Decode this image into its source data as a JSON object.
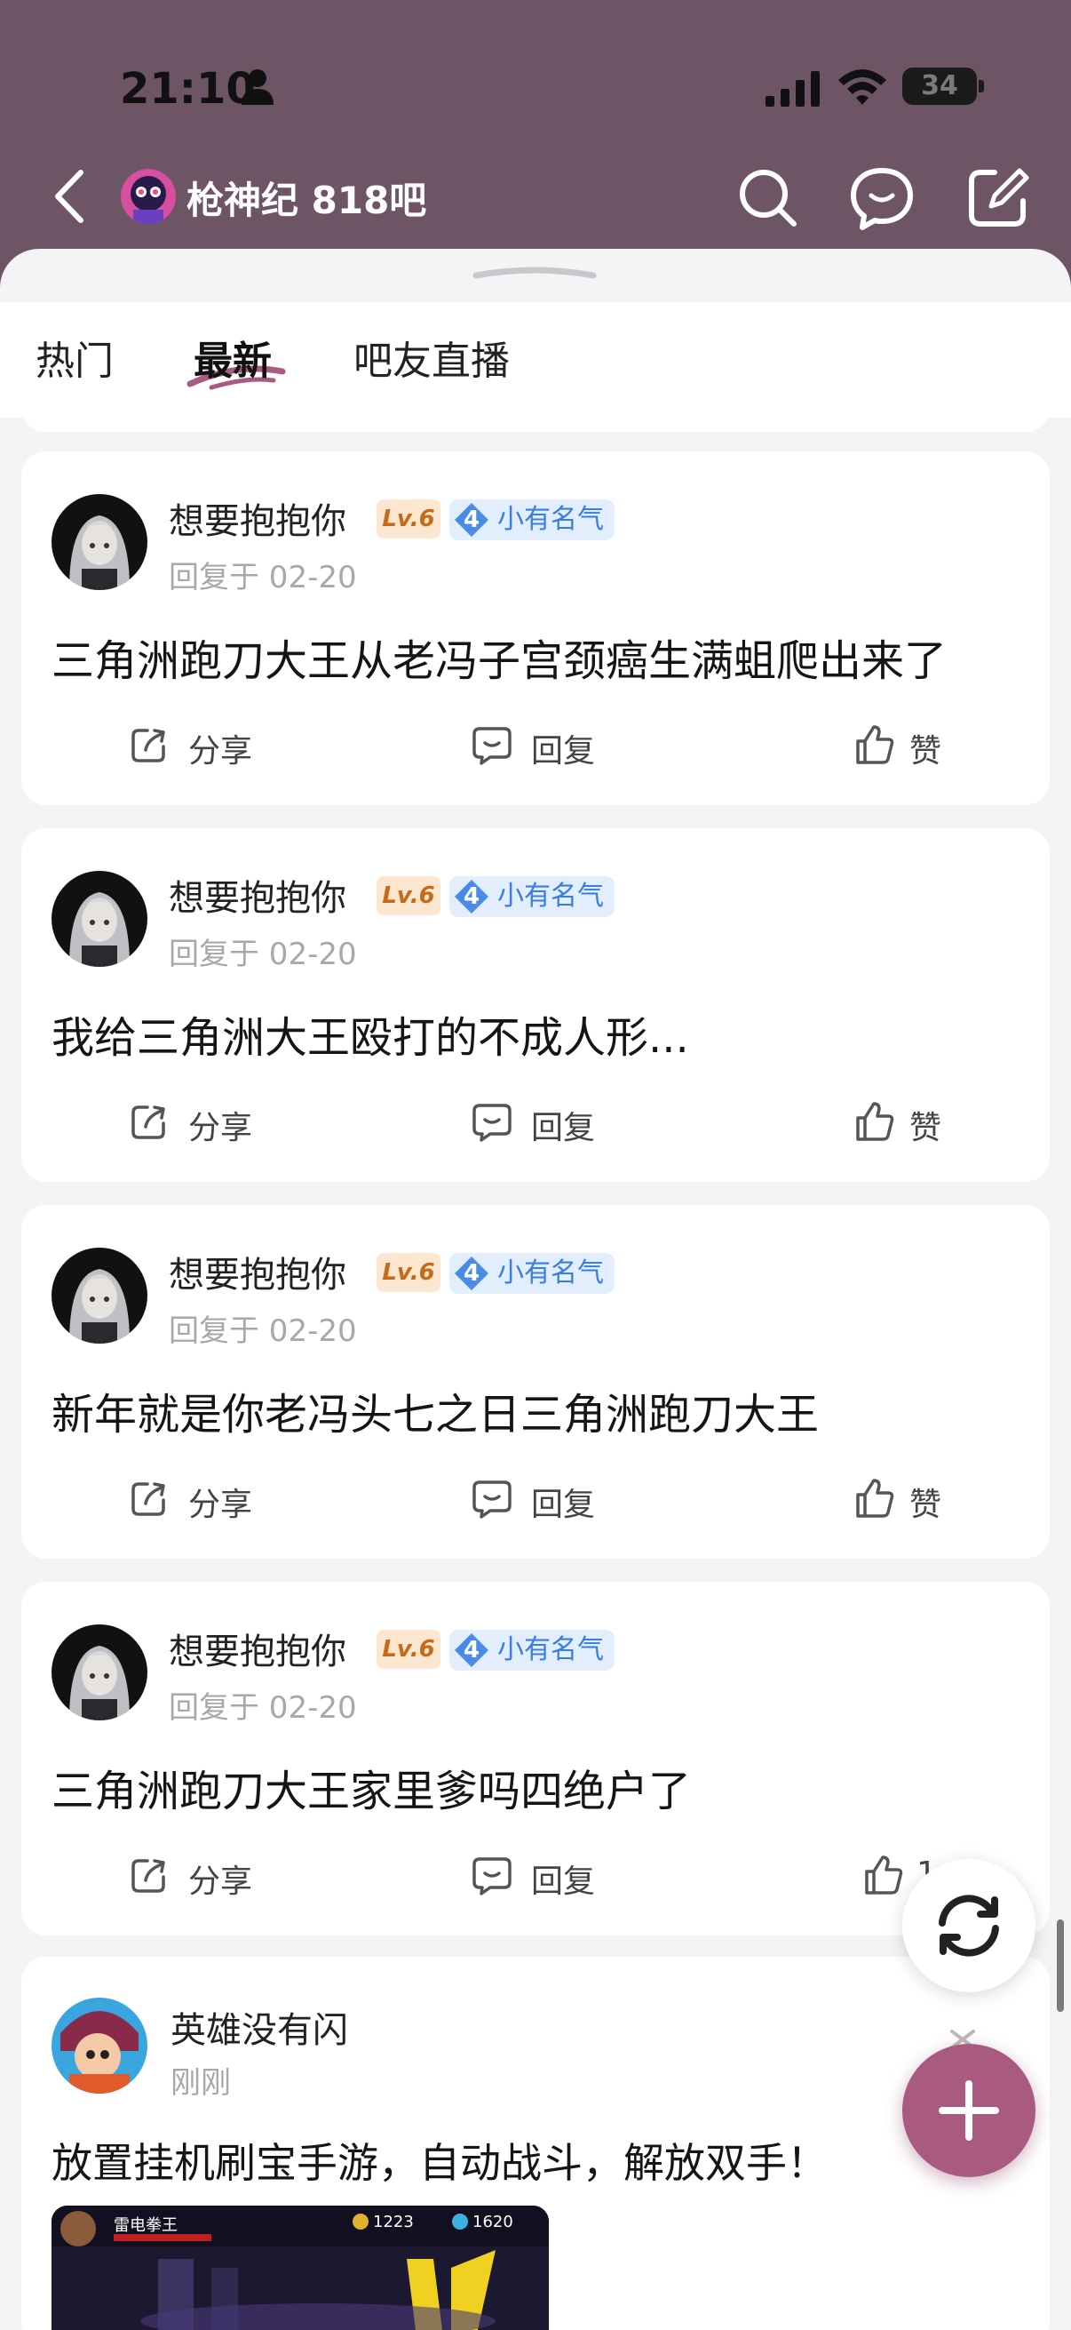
{
  "status": {
    "time": "21:10",
    "battery": "34"
  },
  "header": {
    "title": "枪神纪 818吧"
  },
  "tabs": [
    {
      "label": "热门"
    },
    {
      "label": "最新"
    },
    {
      "label": "吧友直播"
    }
  ],
  "active_tab": "最新",
  "posts": [
    {
      "username": "想要抱抱你",
      "level": "Lv.6",
      "fame_level": "4",
      "fame_label": "小有名气",
      "meta": "回复于 02-20",
      "content": "三角洲跑刀大王从老冯子宫颈癌生满蛆爬出来了",
      "share": "分享",
      "reply": "回复",
      "like": "赞"
    },
    {
      "username": "想要抱抱你",
      "level": "Lv.6",
      "fame_level": "4",
      "fame_label": "小有名气",
      "meta": "回复于 02-20",
      "content": "我给三角洲大王殴打的不成人形...",
      "share": "分享",
      "reply": "回复",
      "like": "赞"
    },
    {
      "username": "想要抱抱你",
      "level": "Lv.6",
      "fame_level": "4",
      "fame_label": "小有名气",
      "meta": "回复于 02-20",
      "content": "新年就是你老冯头七之日三角洲跑刀大王",
      "share": "分享",
      "reply": "回复",
      "like": "赞"
    },
    {
      "username": "想要抱抱你",
      "level": "Lv.6",
      "fame_level": "4",
      "fame_label": "小有名气",
      "meta": "回复于 02-20",
      "content": "三角洲跑刀大王家里爹吗四绝户了",
      "share": "分享",
      "reply": "回复",
      "like": "1"
    }
  ],
  "ad": {
    "username": "英雄没有闪",
    "meta": "刚刚",
    "content": "放置挂机刷宝手游，自动战斗，解放双手！",
    "image": {
      "player_name": "雷电拳王",
      "gold": "1223",
      "gems": "1620"
    }
  },
  "colors": {
    "header_bg": "#6e5565",
    "accent": "#a85a80",
    "level_badge_text": "#c66a18",
    "fame_blue": "#3a7de0"
  }
}
